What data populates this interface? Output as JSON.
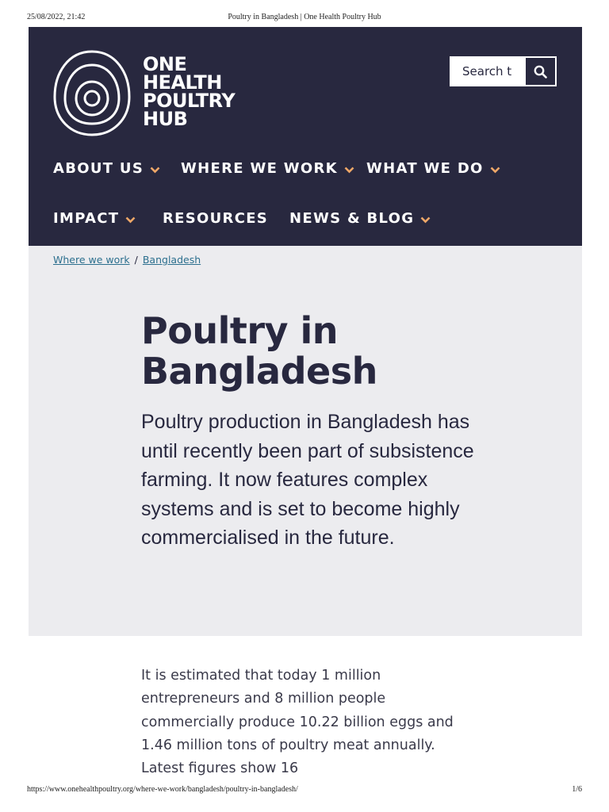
{
  "print": {
    "date": "25/08/2022, 21:42",
    "title": "Poultry in Bangladesh | One Health Poultry Hub",
    "url": "https://www.onehealthpoultry.org/where-we-work/bangladesh/poultry-in-bangladesh/",
    "page": "1/6"
  },
  "header": {
    "logo_lines": [
      "ONE",
      "HEALTH",
      "POULTRY",
      "HUB"
    ],
    "search_placeholder": "Search t",
    "search_icon": "search-icon",
    "nav": [
      {
        "label": "ABOUT US",
        "has_dropdown": true
      },
      {
        "label": "WHERE WE WORK",
        "has_dropdown": true
      },
      {
        "label": "WHAT WE DO",
        "has_dropdown": true
      },
      {
        "label": "IMPACT",
        "has_dropdown": true
      },
      {
        "label": "RESOURCES",
        "has_dropdown": false
      },
      {
        "label": "NEWS & BLOG",
        "has_dropdown": true
      }
    ]
  },
  "breadcrumb": {
    "items": [
      "Where we work",
      "Bangladesh"
    ],
    "separator": "/"
  },
  "hero": {
    "title": "Poultry in Bangladesh",
    "intro": "Poultry production in Bangladesh has until recently been part of subsistence farming. It now features complex systems and is set to become highly commercialised in the future."
  },
  "body": {
    "paragraph": "It is estimated that today 1 million entrepreneurs and 8 million people commercially produce 10.22 billion eggs and 1.46 million tons of poultry meat annually.  Latest figures show 16"
  },
  "colors": {
    "navy": "#28283f",
    "hero_bg": "#ececef",
    "accent_chevron": "#f0a868",
    "link": "#2c6f8e"
  }
}
